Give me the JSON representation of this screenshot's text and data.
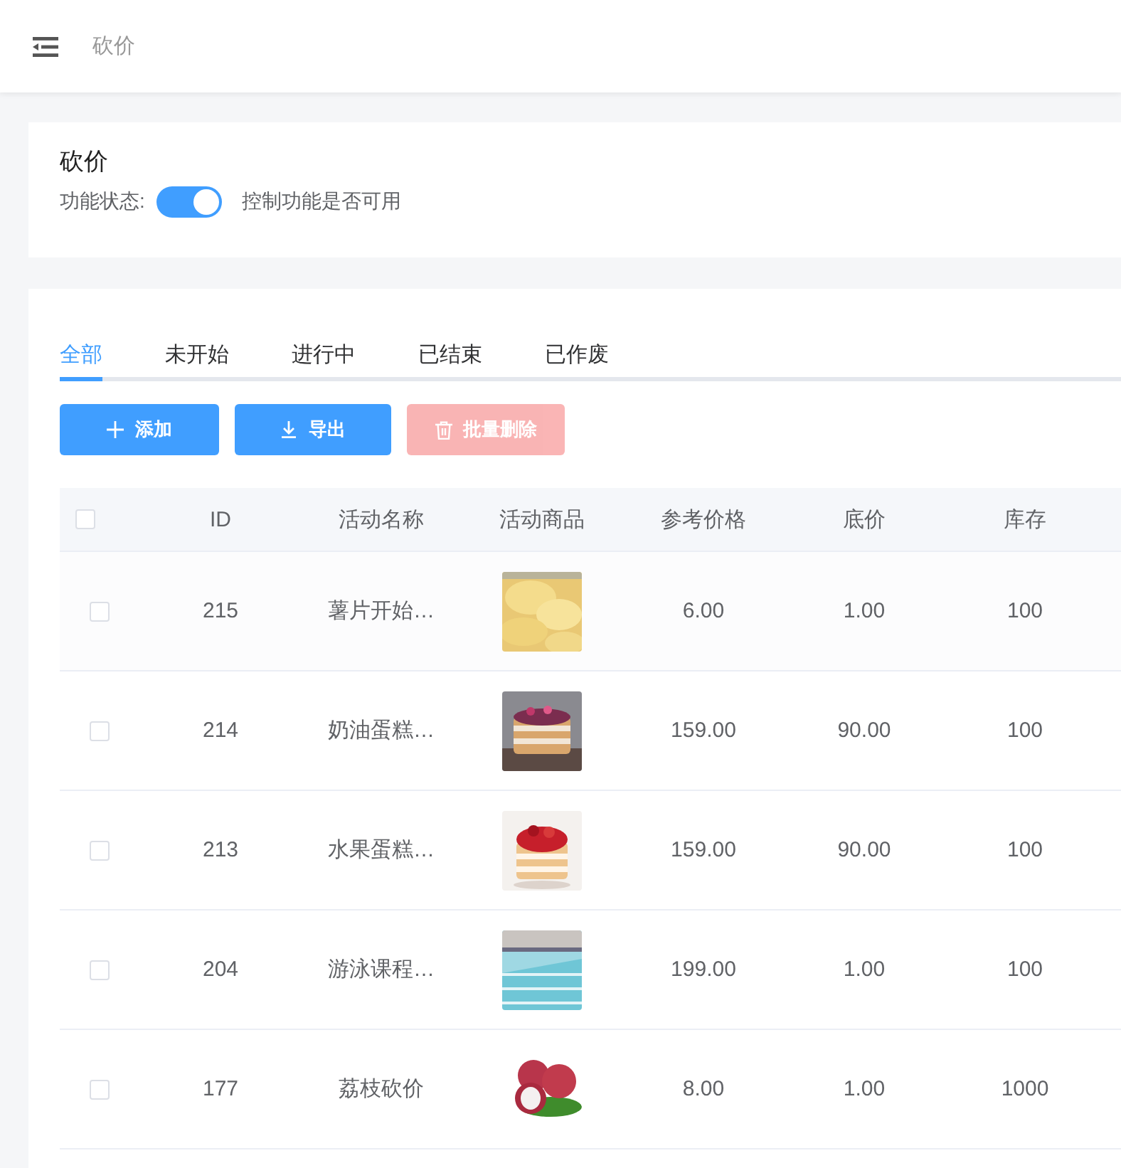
{
  "header": {
    "title": "砍价"
  },
  "feature_card": {
    "title": "砍价",
    "switch_label": "功能状态:",
    "switch": {
      "on": true
    },
    "hint": "控制功能是否可用"
  },
  "tabs": [
    {
      "label": "全部",
      "selected": true
    },
    {
      "label": "未开始",
      "selected": false
    },
    {
      "label": "进行中",
      "selected": false
    },
    {
      "label": "已结束",
      "selected": false
    },
    {
      "label": "已作废",
      "selected": false
    }
  ],
  "buttons": [
    {
      "kind": "add",
      "label": "添加",
      "disabled": false
    },
    {
      "kind": "export",
      "label": "导出",
      "disabled": false
    },
    {
      "kind": "delete",
      "label": "批量删除",
      "disabled": true
    }
  ],
  "table": {
    "columns": [
      "ID",
      "活动名称",
      "活动商品",
      "参考价格",
      "底价",
      "库存"
    ],
    "header_checkbox": {
      "checked": false
    },
    "rows": [
      {
        "checked": false,
        "id": "215",
        "name": "薯片开始…",
        "reference_price": "6.00",
        "base_price": "1.00",
        "stock": "100"
      },
      {
        "checked": false,
        "id": "214",
        "name": "奶油蛋糕…",
        "reference_price": "159.00",
        "base_price": "90.00",
        "stock": "100"
      },
      {
        "checked": false,
        "id": "213",
        "name": "水果蛋糕…",
        "reference_price": "159.00",
        "base_price": "90.00",
        "stock": "100"
      },
      {
        "checked": false,
        "id": "204",
        "name": "游泳课程…",
        "reference_price": "199.00",
        "base_price": "1.00",
        "stock": "100"
      },
      {
        "checked": false,
        "id": "177",
        "name": "荔枝砍价",
        "reference_price": "8.00",
        "base_price": "1.00",
        "stock": "1000"
      }
    ]
  }
}
